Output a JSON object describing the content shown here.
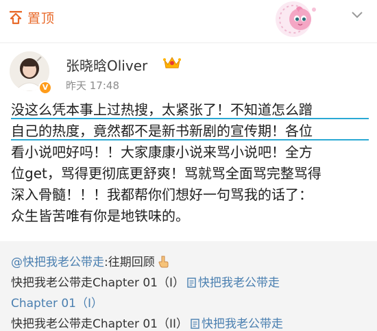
{
  "header": {
    "pin_label": "置顶"
  },
  "post": {
    "author": "张晓晗Oliver",
    "time": "昨天 17:48",
    "lines": [
      "没这么凭本事上过热搜，太紧张了！不知道怎么蹭",
      "自己的热度，竟然都不是新书新剧的宣传期！各位",
      "看小说吧好吗！！大家康康小说来骂小说吧！全方",
      "位get，骂得更彻底更舒爽！骂就骂全面骂完整骂得",
      "深入骨髓！！！我都帮你们想好一句骂我的话了：",
      "众生皆苦唯有你是地铁味的。"
    ]
  },
  "quote": {
    "mention": "@快把我老公带走",
    "mention_suffix": ":往期回顾",
    "row2_text": "快把我老公带走Chapter 01（I）",
    "row2_link": "快把我老公带走",
    "row3_link": "Chapter 01（I）",
    "row4_text": "快把我老公带走Chapter 01（II）",
    "row4_link": "快把我老公带走"
  },
  "colors": {
    "pin": "#e86a2a",
    "underline": "#2aa9d4",
    "link": "#4a7fb0",
    "badge": "#ff9c1a"
  }
}
